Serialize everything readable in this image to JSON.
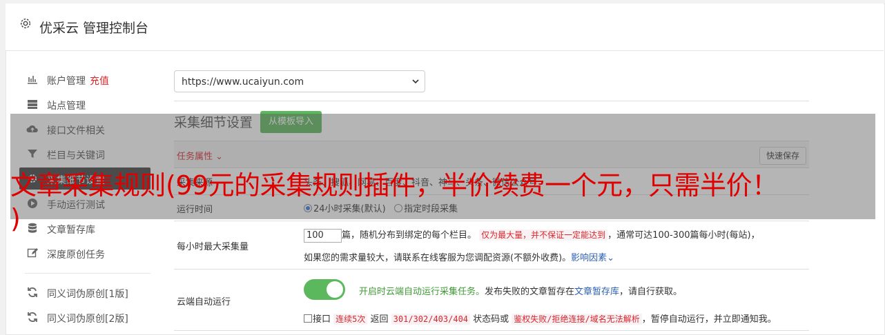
{
  "header": {
    "title": "优采云 管理控制台"
  },
  "sidebar": {
    "items": [
      {
        "label": "账户管理",
        "extra": "充值",
        "icon": "bar-chart-icon"
      },
      {
        "label": "站点管理",
        "icon": "server-icon"
      },
      {
        "label": "接口文件相关",
        "icon": "cloud-upload-icon"
      },
      {
        "label": "栏目与关键词",
        "icon": "filter-icon"
      },
      {
        "label": "采集细节设置",
        "icon": "gear-icon",
        "active": true
      },
      {
        "label": "手动运行测试",
        "icon": "play-circle-icon"
      },
      {
        "label": "文章暂存库",
        "icon": "database-icon"
      },
      {
        "label": "深度原创任务",
        "icon": "edit-icon"
      },
      {
        "label": "同义词伪原创[1版]",
        "icon": "refresh-icon"
      },
      {
        "label": "同义词伪原创[2版]",
        "icon": "refresh-icon"
      }
    ]
  },
  "main": {
    "site_select": {
      "value": "https://www.ucaiyun.com"
    },
    "section_title": "采集细节设置",
    "import_button": "从模板导入",
    "task_attr_label": "任务属性",
    "quick_save": "快速保存",
    "rows": {
      "source": {
        "label": "采集来源",
        "text": "头条、搜狐、网易、百度、抖音、神马、头条、微信公众号"
      },
      "runtime": {
        "label": "运行时间",
        "opt1": "24小时采集(默认)",
        "opt2": "指定时段采集"
      },
      "max_per_hour": {
        "label": "每小时最大采集量",
        "value": "100",
        "text1": "篇，随机分布到绑定的每个栏目。",
        "code": "仅为最大量，并不保证一定能达到",
        "text2": "，通常可达100-300篇每小时(每站)，",
        "text3": "如果您的需求量较大，请联系在线客服为您调配资源(不额外收费)。",
        "link": "影响因素"
      },
      "cloud_run": {
        "label": "云端自动运行",
        "green": "开启时云端自动运行采集任务。",
        "text1": "发布失败的文章暂存在",
        "link": "文章暂存库",
        "text2": "，请自行获取。",
        "cb_label": "接口",
        "code1": "连续5次",
        "t3": " 返回 ",
        "code2": "301/302/403/404",
        "t4": " 状态码或 ",
        "code3": "鉴权失败/拒绝连接/域名无法解析",
        "t5": "，暂停自动运行，并立即通知我。"
      }
    }
  },
  "overlay": {
    "line1": "文章采集规则(99元的采集规则插件，半价续费一个元，只需半价！",
    "line2": ")"
  },
  "colors": {
    "accent_green": "#5cb85c",
    "alert_red": "#d9262b",
    "link_blue": "#2b5fb4"
  }
}
